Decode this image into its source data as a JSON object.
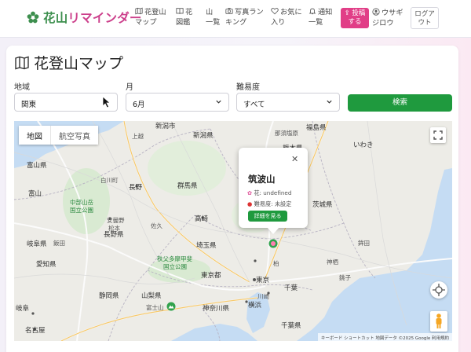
{
  "header": {
    "brand": {
      "part1": "花山",
      "part2": "リマインダー"
    },
    "nav": [
      {
        "line1": "花登山",
        "line2": "マップ",
        "icon": "map-icon"
      },
      {
        "line1": "花",
        "line2": "図鑑",
        "icon": "book-icon"
      },
      {
        "line1": "山",
        "line2": "一覧",
        "icon": "mountain-icon"
      },
      {
        "line1": "写真ラン",
        "line2": "キング",
        "icon": "camera-icon"
      },
      {
        "line1": "お気に",
        "line2": "入り",
        "icon": "heart-icon"
      },
      {
        "line1": "通知",
        "line2": "一覧",
        "icon": "bell-icon"
      }
    ],
    "post_button": {
      "line1": "投稿",
      "line2": "する"
    },
    "user": {
      "line1": "ウサギ",
      "line2": "ジロウ"
    },
    "logout": {
      "line1": "ログア",
      "line2": "ウト"
    }
  },
  "page": {
    "title": "花登山マップ"
  },
  "filters": {
    "region": {
      "label": "地域",
      "value": "関東"
    },
    "month": {
      "label": "月",
      "value": "6月"
    },
    "difficulty": {
      "label": "難易度",
      "value": "すべて"
    },
    "search_label": "検索"
  },
  "map": {
    "type_buttons": {
      "map": "地図",
      "satellite": "航空写真"
    },
    "popup": {
      "name": "筑波山",
      "flower": "花: undefined",
      "difficulty": "難易度: 未設定",
      "detail_label": "詳細を見る",
      "close": "✕"
    },
    "places": {
      "niigata_city": "新潟市",
      "niigata_ken": "新潟県",
      "joetsu": "上越",
      "fukushima_ken": "福島県",
      "tochigi_ken": "栃木県",
      "nasushiobara": "那須塩原",
      "iwaki": "いわき",
      "shirakawa": "白川町",
      "toyama_ken": "富山県",
      "nagano": "長野",
      "gunma_ken": "群馬県",
      "ibaraki_ken": "茨城県",
      "toyama": "富山",
      "chubusangaku_1": "中部山岳",
      "chubusangaku_2": "国立公園",
      "azumino": "安曇野",
      "matsumoto": "松本",
      "saku": "佐久",
      "takasaki": "高崎",
      "nagano_ken": "長野県",
      "gifu_ken_top": "岐阜県",
      "saitama_ken": "埼玉県",
      "chichibu_1": "秩父多摩甲斐",
      "chichibu_2": "国立公園",
      "hokota": "鉾田",
      "kamisu": "神栖",
      "choshi": "銚子",
      "tokyo_to": "東京都",
      "tokyo": "東京",
      "chiba": "千葉",
      "kashiwa": "柏",
      "yamanashi_ken": "山梨県",
      "kawasaki": "川崎",
      "yokohama": "横浜",
      "kanagawa_ken": "神奈川県",
      "mt_fuji": "富士山",
      "shizuoka_ken": "静岡県",
      "chiba_ken": "千葉県",
      "gifu": "岐阜",
      "nagoya": "名古屋",
      "aichi_ken": "愛知県",
      "iida": "飯田"
    },
    "attribution": "キーボード ショートカット   地図データ ©2025 Google   利用規約"
  }
}
